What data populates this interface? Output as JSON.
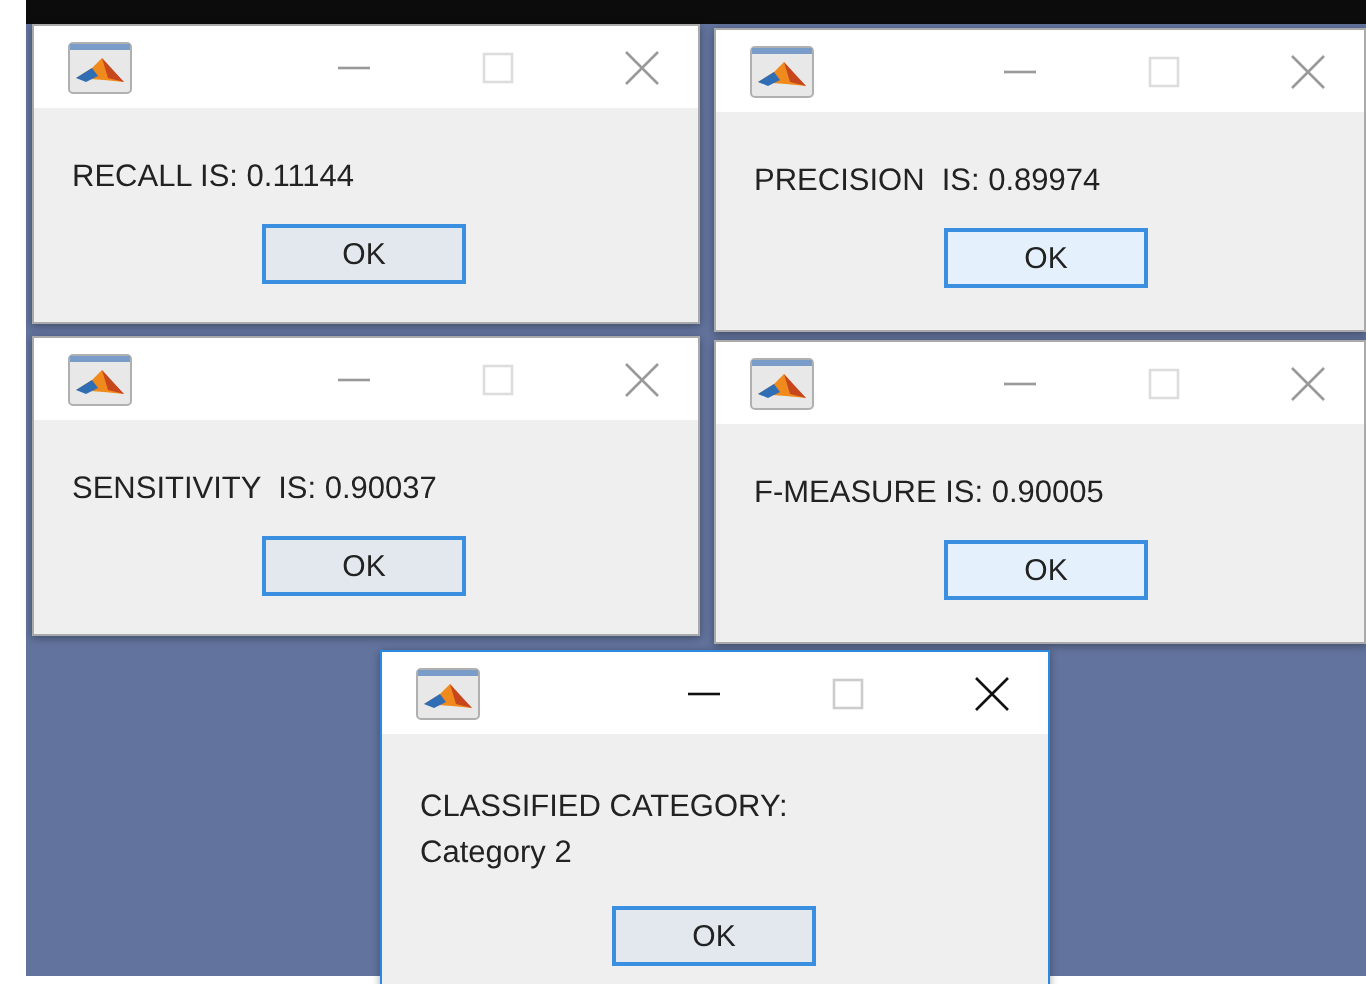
{
  "windows": [
    {
      "active": false,
      "message_lines": [
        "RECALL IS: 0.11144"
      ],
      "button": "OK"
    },
    {
      "active": false,
      "message_lines": [
        "PRECISION  IS: 0.89974"
      ],
      "button": "OK"
    },
    {
      "active": false,
      "message_lines": [
        "SENSITIVITY  IS: 0.90037"
      ],
      "button": "OK"
    },
    {
      "active": false,
      "message_lines": [
        "F-MEASURE IS: 0.90005"
      ],
      "button": "OK"
    },
    {
      "active": true,
      "message_lines": [
        "CLASSIFIED CATEGORY:",
        "Category 2"
      ],
      "button": "OK"
    }
  ]
}
